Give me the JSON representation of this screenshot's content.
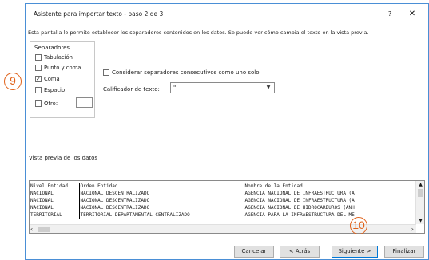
{
  "window": {
    "title": "Asistente para importar texto - paso 2 de 3",
    "help_label": "?",
    "close_label": "✕"
  },
  "description": "Esta pantalla le permite establecer los separadores contenidos en los datos. Se puede ver cómo cambia el texto en la vista previa.",
  "separators": {
    "group_label": "Separadores",
    "options": [
      {
        "label": "Tabulación",
        "checked": false
      },
      {
        "label": "Punto y coma",
        "checked": false
      },
      {
        "label": "Coma",
        "checked": true
      },
      {
        "label": "Espacio",
        "checked": false
      },
      {
        "label": "Otro:",
        "checked": false
      }
    ],
    "other_value": ""
  },
  "consecutive": {
    "label": "Considerar separadores consecutivos como uno solo",
    "checked": false
  },
  "qualifier": {
    "label": "Calificador de texto:",
    "value": "\""
  },
  "preview": {
    "label": "Vista previa de los datos",
    "rows": [
      [
        "Nivel Entidad",
        "Orden Entidad",
        "Nombre de la Entidad"
      ],
      [
        "NACIONAL",
        "NACIONAL DESCENTRALIZADO",
        "AGENCIA NACIONAL DE INFRAESTRUCTURA (A"
      ],
      [
        "NACIONAL",
        "NACIONAL DESCENTRALIZADO",
        "AGENCIA NACIONAL DE INFRAESTRUCTURA (A"
      ],
      [
        "NACIONAL",
        "NACIONAL DESCENTRALIZADO",
        "AGENCIA NACIONAL DE HIDROCARBUROS (ANH"
      ],
      [
        "TERRITORIAL",
        "TERRITORIAL DEPARTAMENTAL CENTRALIZADO",
        "AGENCIA PARA LA INFRAESTRUCTURA DEL ME"
      ]
    ]
  },
  "buttons": {
    "cancel": "Cancelar",
    "back": "< Atrás",
    "next": "Siguiente >",
    "finish": "Finalizar"
  },
  "annotations": {
    "marker_9": "9",
    "marker_10": "10"
  },
  "colors": {
    "accent": "#0078d7",
    "marker": "#e0621a"
  }
}
